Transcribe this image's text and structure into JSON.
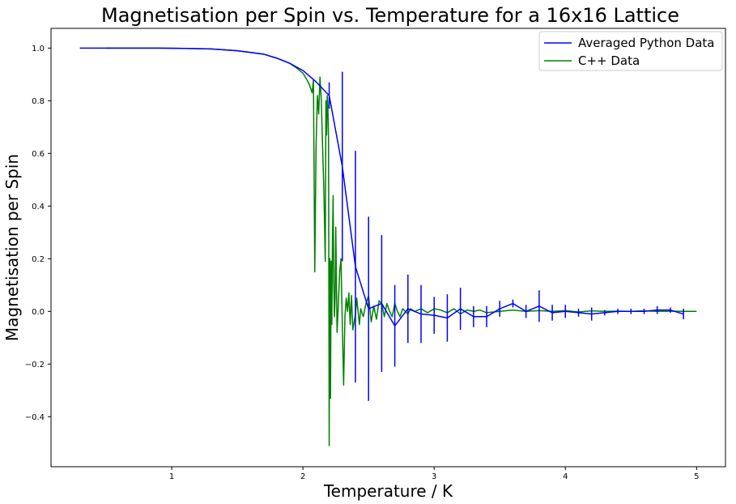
{
  "chart_data": {
    "type": "line",
    "title": "Magnetisation per Spin vs. Temperature for a 16x16 Lattice",
    "xlabel": "Temperature / K",
    "ylabel": "Magnetisation per Spin",
    "xlim": [
      0.08,
      5.22
    ],
    "ylim": [
      -0.59,
      1.075
    ],
    "xticks": [
      1,
      2,
      3,
      4,
      5
    ],
    "xtick_labels": [
      "1",
      "2",
      "3",
      "4",
      "5"
    ],
    "yticks": [
      -0.4,
      -0.2,
      0.0,
      0.2,
      0.4,
      0.6,
      0.8,
      1.0
    ],
    "ytick_labels": [
      "−0.4",
      "−0.2",
      "0.0",
      "0.2",
      "0.4",
      "0.6",
      "0.8",
      "1.0"
    ],
    "grid": false,
    "legend_position": "top-right",
    "series": [
      {
        "name": "Averaged Python Data",
        "color": "#0000ff",
        "errorbars": true,
        "x": [
          0.3,
          0.5,
          0.7,
          0.9,
          1.1,
          1.3,
          1.5,
          1.7,
          1.8,
          1.9,
          2.0,
          2.1,
          2.2,
          2.3,
          2.4,
          2.5,
          2.6,
          2.7,
          2.8,
          2.9,
          3.0,
          3.1,
          3.2,
          3.3,
          3.4,
          3.5,
          3.6,
          3.7,
          3.8,
          3.9,
          4.0,
          4.1,
          4.2,
          4.3,
          4.4,
          4.5,
          4.6,
          4.7,
          4.8,
          4.9
        ],
        "y": [
          1.0,
          1.0,
          1.0,
          1.0,
          0.999,
          0.997,
          0.99,
          0.977,
          0.962,
          0.942,
          0.915,
          0.872,
          0.82,
          0.55,
          0.17,
          0.01,
          0.03,
          -0.055,
          0.01,
          -0.01,
          -0.015,
          -0.025,
          0.01,
          -0.02,
          -0.02,
          0.01,
          0.03,
          0.0,
          0.02,
          -0.005,
          0.0,
          -0.005,
          -0.01,
          -0.005,
          0.0,
          0.0,
          0.0,
          0.005,
          0.005,
          -0.01
        ],
        "yerr": [
          0,
          0,
          0,
          0,
          0,
          0,
          0,
          0,
          0,
          0,
          0,
          0,
          0.05,
          0.36,
          0.44,
          0.35,
          0.26,
          0.155,
          0.13,
          0.11,
          0.07,
          0.09,
          0.08,
          0.04,
          0.04,
          0.03,
          0.015,
          0.025,
          0.06,
          0.03,
          0.025,
          0.015,
          0.025,
          0.01,
          0.01,
          0.01,
          0.01,
          0.015,
          0.01,
          0.02
        ]
      },
      {
        "name": "C++ Data",
        "color": "#008000",
        "errorbars": false,
        "x": [
          0.5,
          0.7,
          0.9,
          1.1,
          1.3,
          1.5,
          1.6,
          1.7,
          1.8,
          1.9,
          1.95,
          2.0,
          2.03,
          2.05,
          2.07,
          2.08,
          2.09,
          2.1,
          2.11,
          2.12,
          2.13,
          2.14,
          2.15,
          2.16,
          2.17,
          2.175,
          2.18,
          2.185,
          2.19,
          2.195,
          2.2,
          2.205,
          2.21,
          2.215,
          2.22,
          2.225,
          2.23,
          2.235,
          2.24,
          2.245,
          2.25,
          2.26,
          2.27,
          2.28,
          2.29,
          2.3,
          2.31,
          2.32,
          2.33,
          2.34,
          2.35,
          2.36,
          2.37,
          2.38,
          2.39,
          2.4,
          2.41,
          2.42,
          2.43,
          2.44,
          2.46,
          2.48,
          2.5,
          2.52,
          2.54,
          2.56,
          2.58,
          2.6,
          2.62,
          2.64,
          2.66,
          2.68,
          2.7,
          2.72,
          2.74,
          2.76,
          2.78,
          2.8,
          2.82,
          2.85,
          2.9,
          2.95,
          3.0,
          3.05,
          3.1,
          3.15,
          3.2,
          3.25,
          3.3,
          3.35,
          3.4,
          3.5,
          3.6,
          3.7,
          3.8,
          3.9,
          4.0,
          4.1,
          4.2,
          4.3,
          4.4,
          4.5,
          4.6,
          4.7,
          4.8,
          4.9,
          5.0
        ],
        "y": [
          1.0,
          1.0,
          1.0,
          0.999,
          0.997,
          0.99,
          0.984,
          0.977,
          0.962,
          0.942,
          0.925,
          0.905,
          0.88,
          0.86,
          0.83,
          0.88,
          0.15,
          0.63,
          0.82,
          0.75,
          0.89,
          0.8,
          0.62,
          0.45,
          0.19,
          0.8,
          0.67,
          0.82,
          0.78,
          0.65,
          -0.51,
          0.2,
          -0.33,
          0.19,
          -0.05,
          0.26,
          0.44,
          0.11,
          -0.02,
          0.05,
          0.32,
          -0.08,
          0.03,
          0.15,
          0.2,
          -0.05,
          -0.28,
          -0.02,
          0.05,
          0.0,
          0.07,
          -0.05,
          0.06,
          -0.07,
          -0.04,
          -0.01,
          0.05,
          0.0,
          -0.05,
          0.01,
          -0.02,
          0.03,
          0.06,
          -0.04,
          0.02,
          -0.03,
          0.04,
          0.03,
          -0.02,
          0.03,
          0.0,
          -0.02,
          0.03,
          0.0,
          -0.02,
          0.01,
          0.0,
          -0.01,
          0.01,
          0.0,
          0.01,
          -0.005,
          0.01,
          0.005,
          -0.005,
          0.01,
          -0.01,
          0.005,
          0.0,
          0.005,
          -0.005,
          0.0,
          0.005,
          0.0,
          0.003,
          0.0,
          0.003,
          -0.002,
          0.002,
          0.0,
          0.001,
          0.0,
          0.002,
          0.0,
          0.001,
          0.0,
          0.0
        ]
      }
    ]
  }
}
